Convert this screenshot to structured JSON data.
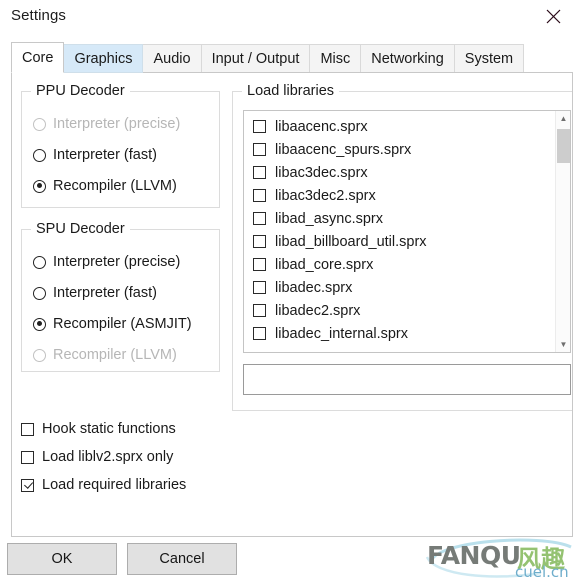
{
  "window": {
    "title": "Settings",
    "close_icon": "close-icon"
  },
  "tabs": [
    {
      "label": "Core",
      "state": "selected"
    },
    {
      "label": "Graphics",
      "state": "hovered"
    },
    {
      "label": "Audio",
      "state": "normal"
    },
    {
      "label": "Input / Output",
      "state": "normal"
    },
    {
      "label": "Misc",
      "state": "normal"
    },
    {
      "label": "Networking",
      "state": "normal"
    },
    {
      "label": "System",
      "state": "normal"
    }
  ],
  "ppu_decoder": {
    "title": "PPU Decoder",
    "options": [
      {
        "label": "Interpreter (precise)",
        "checked": false,
        "disabled": true
      },
      {
        "label": "Interpreter (fast)",
        "checked": false,
        "disabled": false
      },
      {
        "label": "Recompiler (LLVM)",
        "checked": true,
        "disabled": false
      }
    ]
  },
  "spu_decoder": {
    "title": "SPU Decoder",
    "options": [
      {
        "label": "Interpreter (precise)",
        "checked": false,
        "disabled": false
      },
      {
        "label": "Interpreter (fast)",
        "checked": false,
        "disabled": false
      },
      {
        "label": "Recompiler (ASMJIT)",
        "checked": true,
        "disabled": false
      },
      {
        "label": "Recompiler (LLVM)",
        "checked": false,
        "disabled": true
      }
    ]
  },
  "load_libraries": {
    "title": "Load libraries",
    "items": [
      {
        "label": "libaacenc.sprx",
        "checked": false
      },
      {
        "label": "libaacenc_spurs.sprx",
        "checked": false
      },
      {
        "label": "libac3dec.sprx",
        "checked": false
      },
      {
        "label": "libac3dec2.sprx",
        "checked": false
      },
      {
        "label": "libad_async.sprx",
        "checked": false
      },
      {
        "label": "libad_billboard_util.sprx",
        "checked": false
      },
      {
        "label": "libad_core.sprx",
        "checked": false
      },
      {
        "label": "libadec.sprx",
        "checked": false
      },
      {
        "label": "libadec2.sprx",
        "checked": false
      },
      {
        "label": "libadec_internal.sprx",
        "checked": false
      }
    ],
    "filter": {
      "value": "",
      "placeholder": ""
    },
    "scroll_up_icon": "chevron-up-icon",
    "scroll_down_icon": "chevron-down-icon"
  },
  "bottom_options": [
    {
      "label": "Hook static functions",
      "checked": false
    },
    {
      "label": "Load liblv2.sprx only",
      "checked": false
    },
    {
      "label": "Load required libraries",
      "checked": true
    }
  ],
  "buttons": {
    "ok": "OK",
    "cancel": "Cancel"
  },
  "watermark": {
    "main": "FANQU",
    "cn": "风趣",
    "sub": "cuel.cn"
  },
  "colors": {
    "tab_hover": "#d6e9f8",
    "button_face": "#e1e1e1",
    "text": "#1a1a1a",
    "disabled_text": "#b6b6b6"
  }
}
